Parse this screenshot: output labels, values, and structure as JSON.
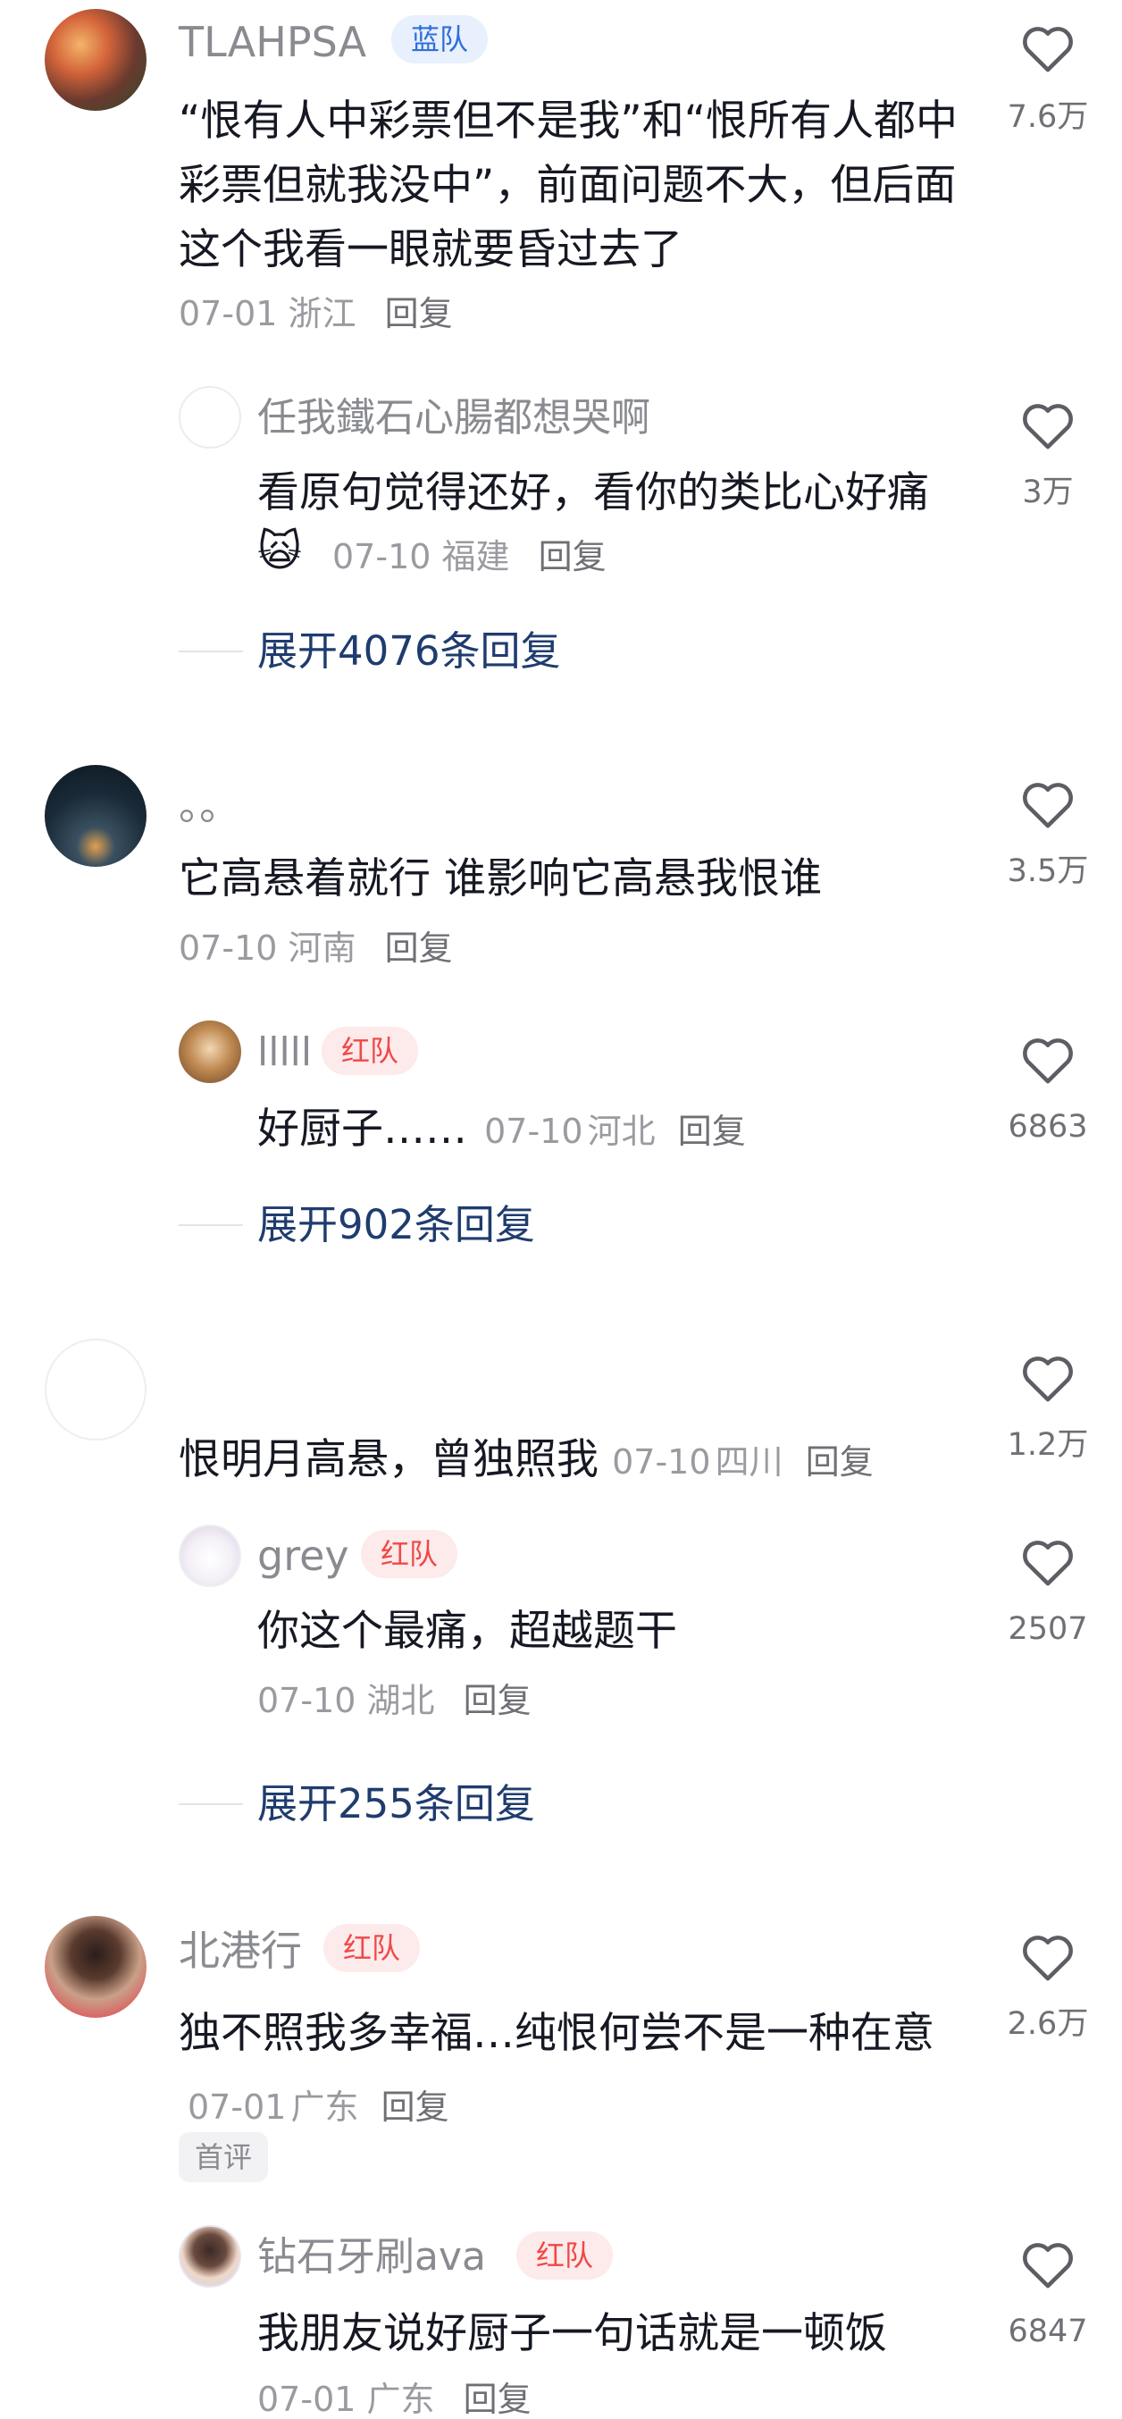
{
  "comments": [
    {
      "user": "TLAHPSA",
      "badge": "蓝队",
      "text": "“恨有人中彩票但不是我”和“恨所有人都中彩票但就我没中”，前面问题不大，但后面这个我看一眼就要昏过去了",
      "date": "07-01",
      "location": "浙江",
      "reply_label": "回复",
      "likes": "7.6万",
      "sub_reply": {
        "user": "任我鐵石心腸都想哭啊",
        "text": "看原句觉得还好，看你的类比心好痛",
        "emoji": "🙀",
        "date": "07-10",
        "location": "福建",
        "reply_label": "回复",
        "likes": "3万"
      },
      "expand_label": "展开4076条回复"
    },
    {
      "user": "。。",
      "text": "它高悬着就行 谁影响它高悬我恨谁",
      "date": "07-10",
      "location": "河南",
      "reply_label": "回复",
      "likes": "3.5万",
      "sub_reply": {
        "user": "lllll",
        "badge": "红队",
        "text": "好厨子……",
        "date": "07-10",
        "location": "河北",
        "reply_label": "回复",
        "likes": "6863"
      },
      "expand_label": "展开902条回复"
    },
    {
      "user": "",
      "text": "恨明月高悬，曾独照我",
      "date": "07-10",
      "location": "四川",
      "reply_label": "回复",
      "likes": "1.2万",
      "sub_reply": {
        "user": "grey",
        "badge": "红队",
        "text": "你这个最痛，超越题干",
        "date": "07-10",
        "location": "湖北",
        "reply_label": "回复",
        "likes": "2507"
      },
      "expand_label": "展开255条回复"
    },
    {
      "user": "北港行",
      "badge": "红队",
      "text": "独不照我多幸福…纯恨何尝不是一种在意",
      "date": "07-01",
      "location": "广东",
      "reply_label": "回复",
      "likes": "2.6万",
      "first_label": "首评",
      "sub_reply": {
        "user": "钻石牙刷ava",
        "badge": "红队",
        "text": "我朋友说好厨子一句话就是一顿饭",
        "date": "07-01",
        "location": "广东",
        "reply_label": "回复",
        "likes": "6847"
      }
    }
  ],
  "icons": {
    "like": "heart-outline-icon"
  },
  "colors": {
    "badge_blue": "#2f6fd9",
    "badge_red": "#f04848",
    "expand": "#1f3c6e"
  }
}
